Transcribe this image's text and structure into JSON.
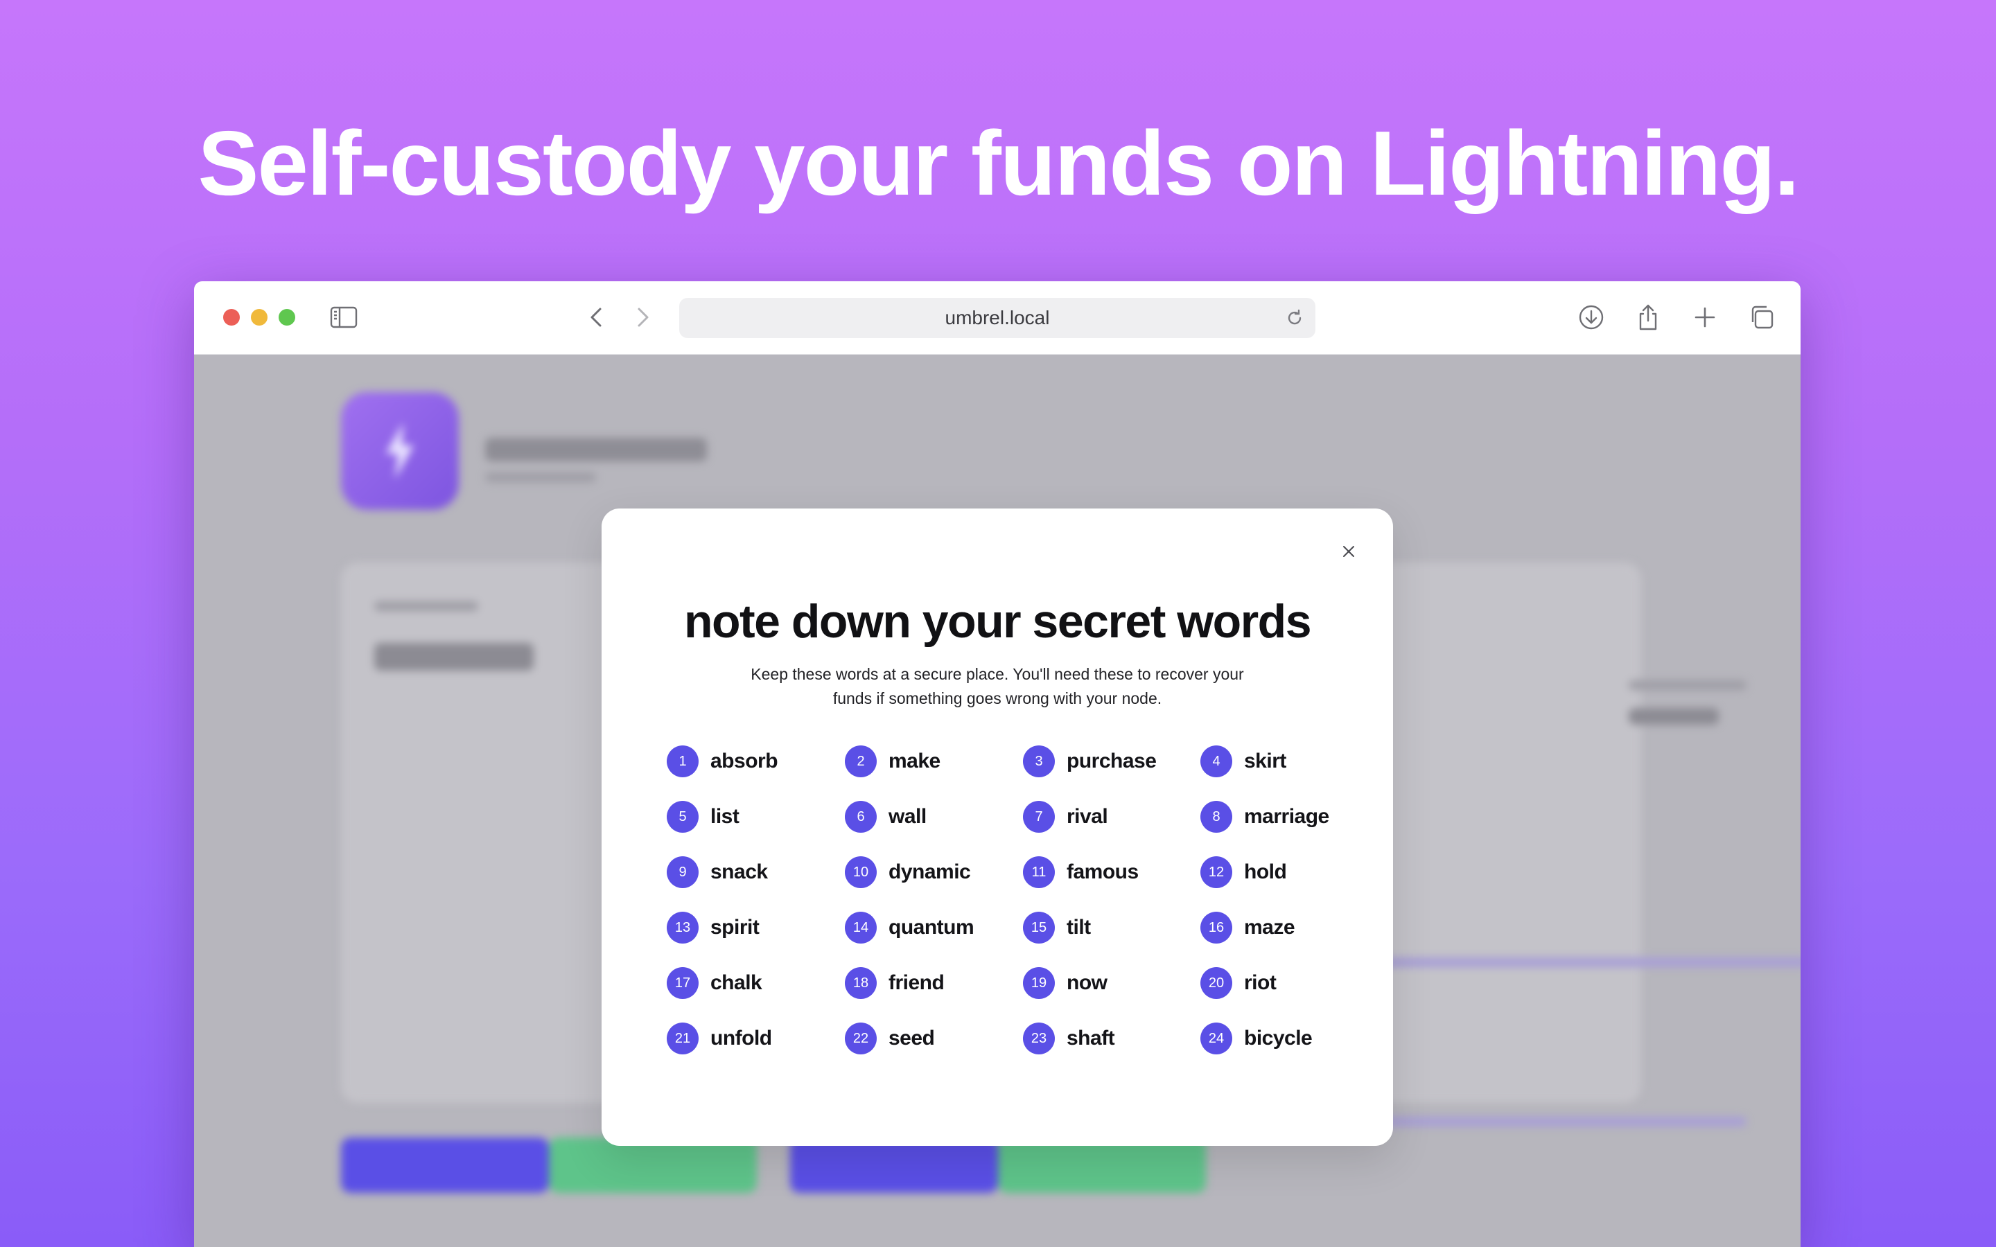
{
  "headline": "Self-custody your funds on Lightning.",
  "browser": {
    "url": "umbrel.local",
    "icons": {
      "sidebar": "sidebar-icon",
      "back": "chevron-left-icon",
      "forward": "chevron-right-icon",
      "reload": "reload-icon",
      "download": "download-icon",
      "share": "share-icon",
      "new_tab": "plus-icon",
      "tabs": "tabs-overview-icon"
    }
  },
  "modal": {
    "title": "note down your secret words",
    "subtitle": "Keep these words at a secure place. You'll need these to recover your funds if something goes wrong with your node.",
    "words": [
      {
        "n": "1",
        "w": "absorb"
      },
      {
        "n": "2",
        "w": "make"
      },
      {
        "n": "3",
        "w": "purchase"
      },
      {
        "n": "4",
        "w": "skirt"
      },
      {
        "n": "5",
        "w": "list"
      },
      {
        "n": "6",
        "w": "wall"
      },
      {
        "n": "7",
        "w": "rival"
      },
      {
        "n": "8",
        "w": "marriage"
      },
      {
        "n": "9",
        "w": "snack"
      },
      {
        "n": "10",
        "w": "dynamic"
      },
      {
        "n": "11",
        "w": "famous"
      },
      {
        "n": "12",
        "w": "hold"
      },
      {
        "n": "13",
        "w": "spirit"
      },
      {
        "n": "14",
        "w": "quantum"
      },
      {
        "n": "15",
        "w": "tilt"
      },
      {
        "n": "16",
        "w": "maze"
      },
      {
        "n": "17",
        "w": "chalk"
      },
      {
        "n": "18",
        "w": "friend"
      },
      {
        "n": "19",
        "w": "now"
      },
      {
        "n": "20",
        "w": "riot"
      },
      {
        "n": "21",
        "w": "unfold"
      },
      {
        "n": "22",
        "w": "seed"
      },
      {
        "n": "23",
        "w": "shaft"
      },
      {
        "n": "24",
        "w": "bicycle"
      }
    ]
  },
  "colors": {
    "accent": "#5a4fe6",
    "background_top": "#c676fb",
    "background_bottom": "#8a5cf8"
  }
}
